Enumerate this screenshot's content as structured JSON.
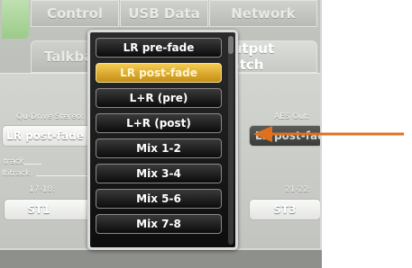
{
  "tabs": {
    "row1": [
      "Control",
      "USB Data",
      "Network"
    ],
    "row2": [
      "Talkback",
      "Output Patch"
    ]
  },
  "left": {
    "qu_drive_label": "Qu-Drive Stereo:",
    "qu_drive_value": "LR post-fade",
    "track_label": "track",
    "multitrack_label": "ltitrack",
    "ch17_18_label": "17-18:",
    "ch17_18_value": "ST1"
  },
  "right": {
    "aes_label": "AES Out:",
    "aes_value": "LR post-fade",
    "ch21_22_label": "21-22:",
    "ch21_22_value": "ST3"
  },
  "menu": {
    "items": [
      "LR pre-fade",
      "LR post-fade",
      "L+R (pre)",
      "L+R (post)",
      "Mix 1-2",
      "Mix 3-4",
      "Mix 5-6",
      "Mix 7-8"
    ],
    "selected": "LR post-fade"
  },
  "annotation": {
    "arrow_color": "#e0701e"
  }
}
